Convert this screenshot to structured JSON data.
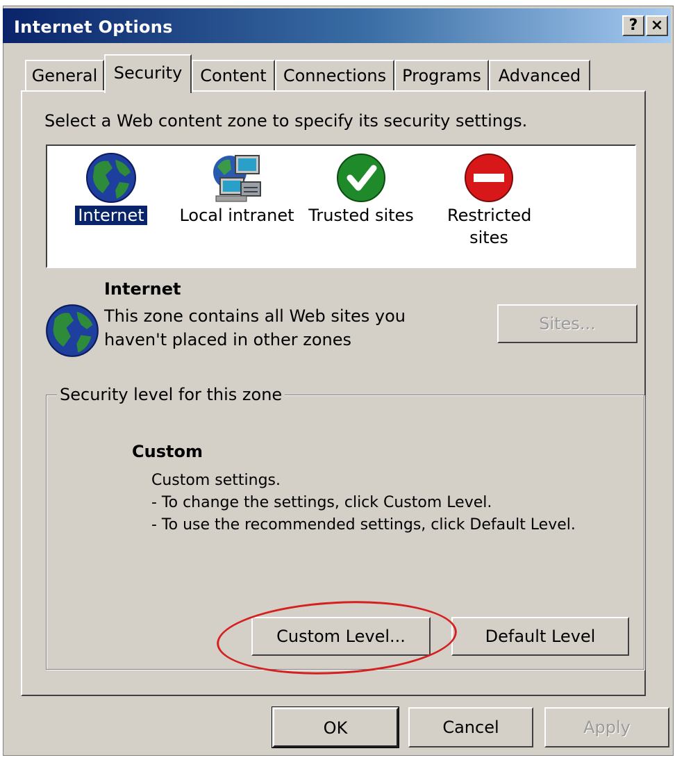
{
  "window": {
    "title": "Internet Options",
    "help_button": "?",
    "close_button": "×"
  },
  "tabs": [
    {
      "label": "General",
      "active": false
    },
    {
      "label": "Security",
      "active": true
    },
    {
      "label": "Content",
      "active": false
    },
    {
      "label": "Connections",
      "active": false
    },
    {
      "label": "Programs",
      "active": false
    },
    {
      "label": "Advanced",
      "active": false
    }
  ],
  "security": {
    "prompt": "Select a Web content zone to specify its security settings.",
    "zones": [
      {
        "label": "Internet",
        "icon": "globe-icon",
        "selected": true
      },
      {
        "label": "Local intranet",
        "icon": "intranet-icon",
        "selected": false
      },
      {
        "label": "Trusted sites",
        "icon": "checkmark-icon",
        "selected": false
      },
      {
        "label": "Restricted sites",
        "icon": "restricted-icon",
        "selected": false
      }
    ],
    "selected_zone": {
      "title": "Internet",
      "description": "This zone contains all Web sites you haven't placed in other zones",
      "icon": "globe-icon"
    },
    "sites_button": "Sites...",
    "level_group": {
      "legend": "Security level for this zone",
      "level_title": "Custom",
      "lines": [
        "Custom settings.",
        "- To change the settings, click Custom Level.",
        "- To use the recommended settings, click Default Level."
      ],
      "custom_level_button": "Custom Level...",
      "default_level_button": "Default Level"
    }
  },
  "footer": {
    "ok": "OK",
    "cancel": "Cancel",
    "apply": "Apply"
  },
  "colors": {
    "titlebar_start": "#0a246a",
    "titlebar_end": "#a6caf0",
    "face": "#d4d0c8",
    "highlight_circle": "#d42020"
  }
}
